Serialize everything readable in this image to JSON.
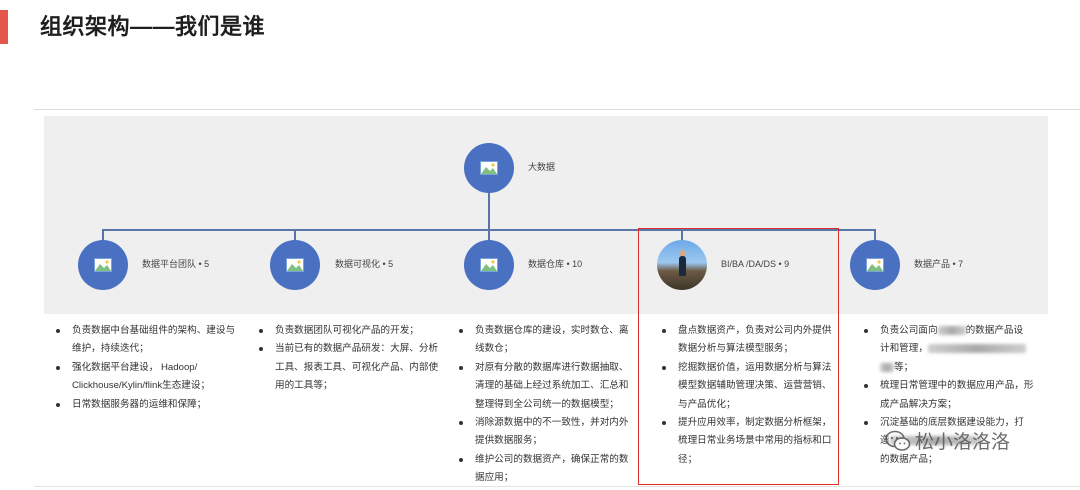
{
  "page": {
    "title": "组织架构——我们是谁"
  },
  "root": {
    "label": "大数据",
    "icon": "image-placeholder-icon"
  },
  "teams": [
    {
      "label": "数据平台团队 • 5",
      "icon": "image-placeholder-icon",
      "bullets": [
        "负责数据中台基础组件的架构、建设与维护，持续迭代；",
        "强化数据平台建设， Hadoop/ Clickhouse/Kylin/flink生态建设；",
        "日常数据服务器的运维和保障；"
      ]
    },
    {
      "label": "数据可视化 • 5",
      "icon": "image-placeholder-icon",
      "bullets": [
        "负责数据团队可视化产品的开发；",
        "当前已有的数据产品研发：大屏、分析工具、报表工具、可视化产品、内部使用的工具等；"
      ]
    },
    {
      "label": "数据仓库 • 10",
      "icon": "image-placeholder-icon",
      "bullets": [
        "负责数据仓库的建设，实时数仓、离线数仓；",
        "对原有分散的数据库进行数据抽取、清理的基础上经过系统加工、汇总和整理得到全公司统一的数据模型；",
        "消除源数据中的不一致性，并对内外提供数据服务；",
        "维护公司的数据资产，确保正常的数据应用；"
      ]
    },
    {
      "label": "BI/BA /DA/DS • 9",
      "icon": "person-photo-avatar",
      "bullets": [
        "盘点数据资产，负责对公司内外提供数据分析与算法模型服务；",
        "挖掘数据价值，运用数据分析与算法模型数据辅助管理决策、运营营销、与产品优化；",
        "提升应用效率，制定数据分析框架，梳理日常业务场景中常用的指标和口径；"
      ]
    },
    {
      "label": "数据产品 • 7",
      "icon": "image-placeholder-icon",
      "bullets_partial": {
        "b1_a": "负责公司面向",
        "b1_b": "的数据产品设",
        "b1_c": "计和管理，",
        "b1_d": "等；",
        "b2": "梳理日常管理中的数据应用产品，形成产品解决方案；",
        "b3_a": "沉淀基础的底层数据建设能力，打",
        "b3_b": "造",
        "b3_c": "的数据产品；"
      }
    }
  ],
  "watermark": {
    "text": "松小洛洛洛",
    "icon": "wechat-icon"
  },
  "colors": {
    "accent": "#e4554a",
    "node": "#4a70c2",
    "connector": "#5a75a8",
    "highlight": "#d9302b",
    "panel": "#efefef"
  }
}
